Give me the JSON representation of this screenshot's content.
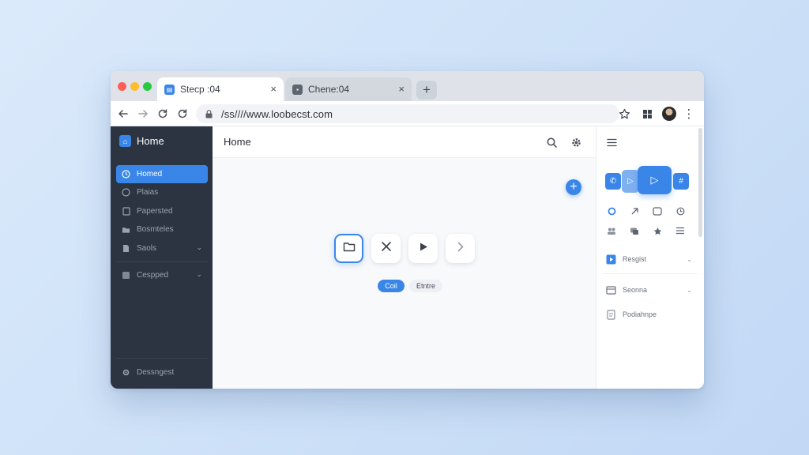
{
  "browser": {
    "tabs": [
      {
        "label": "Stecp :04",
        "close": "×"
      },
      {
        "label": "Chene:04",
        "close": "×"
      }
    ],
    "new_tab": "+",
    "url": "/ss////www.loobecst.com"
  },
  "sidebar": {
    "title": "Home",
    "items": [
      {
        "label": "Homed"
      },
      {
        "label": "Plaias"
      },
      {
        "label": "Papersted"
      },
      {
        "label": "Bosmteles"
      },
      {
        "label": "Saols"
      },
      {
        "label": "Cespped"
      }
    ],
    "footer": {
      "label": "Dessngest"
    }
  },
  "main": {
    "title": "Home",
    "chips": {
      "primary": "Coil",
      "secondary": "Etntre"
    }
  },
  "right_panel": {
    "rows": [
      {
        "label": "Resgist"
      },
      {
        "label": "Seonna"
      },
      {
        "label": "Podiahnpe"
      }
    ]
  },
  "colors": {
    "accent": "#3a86e8",
    "sidebar_bg": "#2c3441",
    "background": "#cfe2f8"
  }
}
